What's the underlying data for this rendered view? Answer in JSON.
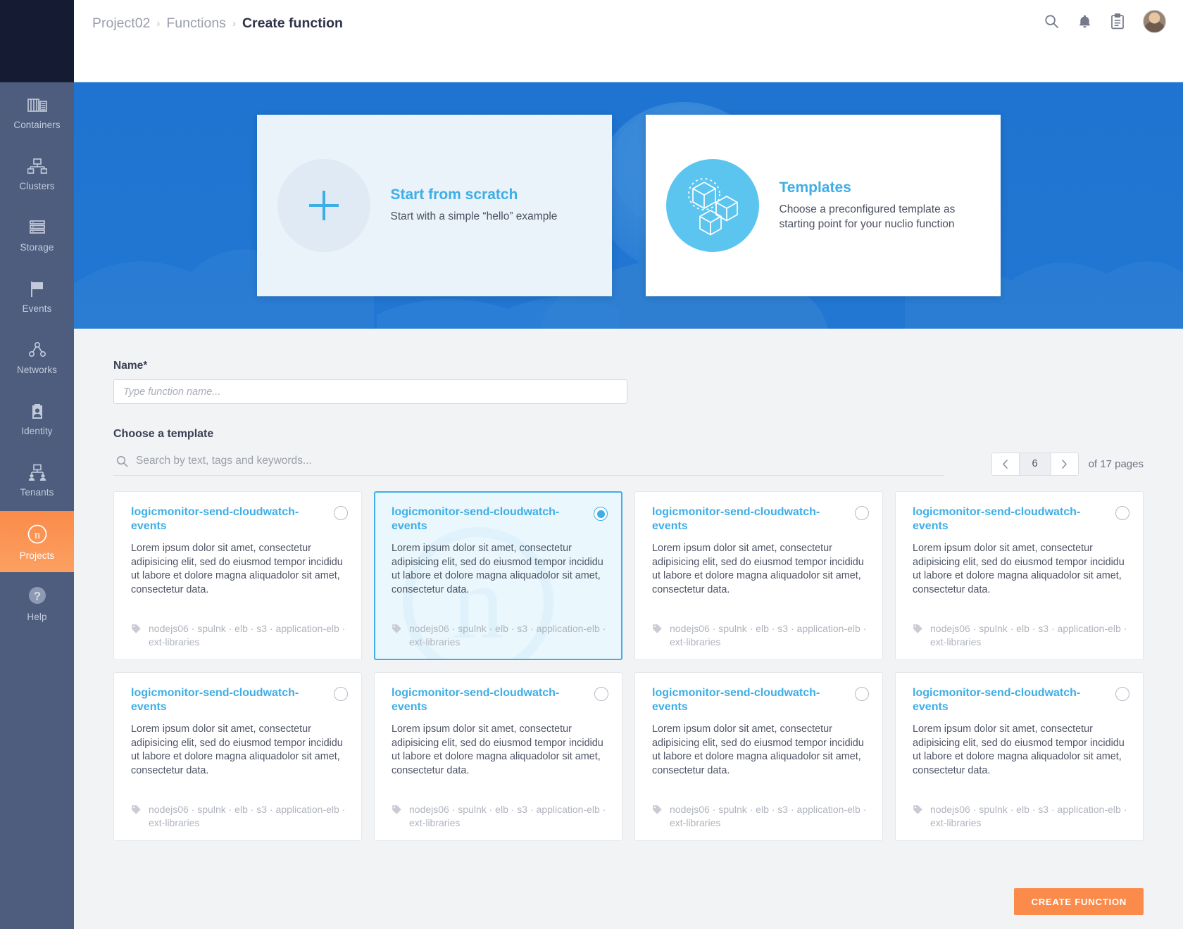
{
  "breadcrumb": {
    "items": [
      {
        "label": "Project02",
        "current": false
      },
      {
        "label": "Functions",
        "current": false
      },
      {
        "label": "Create function",
        "current": true
      }
    ],
    "separator": "›"
  },
  "header": {
    "icons": [
      "search-icon",
      "bell-icon",
      "clipboard-icon",
      "user-avatar"
    ]
  },
  "sidebar": {
    "items": [
      {
        "label": "Containers",
        "icon": "containers-icon",
        "active": false
      },
      {
        "label": "Clusters",
        "icon": "clusters-icon",
        "active": false
      },
      {
        "label": "Storage",
        "icon": "storage-icon",
        "active": false
      },
      {
        "label": "Events",
        "icon": "flag-icon",
        "active": false
      },
      {
        "label": "Networks",
        "icon": "networks-icon",
        "active": false
      },
      {
        "label": "Identity",
        "icon": "identity-badge-icon",
        "active": false
      },
      {
        "label": "Tenants",
        "icon": "tenants-icon",
        "active": false
      },
      {
        "label": "Projects",
        "icon": "nuclio-n-icon",
        "active": true
      },
      {
        "label": "Help",
        "icon": "question-circle-icon",
        "active": false
      }
    ]
  },
  "hero": {
    "cards": [
      {
        "id": "start-from-scratch",
        "title": "Start from scratch",
        "subtitle": "Start with a simple “hello” example",
        "icon": "plus-icon"
      },
      {
        "id": "templates",
        "title": "Templates",
        "subtitle": "Choose a preconfigured template as\nstarting point for your nuclio function",
        "icon": "cubes-icon"
      }
    ]
  },
  "form": {
    "name_label": "Name*",
    "name_value": "",
    "name_placeholder": "Type function name...",
    "section_title": "Choose a template"
  },
  "search": {
    "value": "",
    "placeholder": "Search by text, tags and keywords...",
    "icon": "search-icon"
  },
  "pagination": {
    "prev_icon": "chevron-left-icon",
    "next_icon": "chevron-right-icon",
    "current_page": "6",
    "total_label": "of 17 pages"
  },
  "templates": [
    {
      "title": "logicmonitor-send-cloudwatch-events",
      "description": "Lorem ipsum dolor sit amet, consectetur adipisicing elit, sed do eiusmod tempor incididu ut labore et dolore magna aliquadolor sit amet, consectetur data.",
      "tags": "nodejs06 · spulnk · elb · s3 · application-elb · ext-libraries",
      "selected": false
    },
    {
      "title": "logicmonitor-send-cloudwatch-events",
      "description": "Lorem ipsum dolor sit amet, consectetur adipisicing elit, sed do eiusmod tempor incididu ut labore et dolore magna aliquadolor sit amet, consectetur data.",
      "tags": "nodejs06 · spulnk · elb · s3 · application-elb · ext-libraries",
      "selected": true
    },
    {
      "title": "logicmonitor-send-cloudwatch-events",
      "description": "Lorem ipsum dolor sit amet, consectetur adipisicing elit, sed do eiusmod tempor incididu ut labore et dolore magna aliquadolor sit amet, consectetur data.",
      "tags": "nodejs06 · spulnk · elb · s3 · application-elb · ext-libraries",
      "selected": false
    },
    {
      "title": "logicmonitor-send-cloudwatch-events",
      "description": "Lorem ipsum dolor sit amet, consectetur adipisicing elit, sed do eiusmod tempor incididu ut labore et dolore magna aliquadolor sit amet, consectetur data.",
      "tags": "nodejs06 · spulnk · elb · s3 · application-elb · ext-libraries",
      "selected": false
    },
    {
      "title": "logicmonitor-send-cloudwatch-events",
      "description": "Lorem ipsum dolor sit amet, consectetur adipisicing elit, sed do eiusmod tempor incididu ut labore et dolore magna aliquadolor sit amet, consectetur data.",
      "tags": "nodejs06 · spulnk · elb · s3 · application-elb · ext-libraries",
      "selected": false
    },
    {
      "title": "logicmonitor-send-cloudwatch-events",
      "description": "Lorem ipsum dolor sit amet, consectetur adipisicing elit, sed do eiusmod tempor incididu ut labore et dolore magna aliquadolor sit amet, consectetur data.",
      "tags": "nodejs06 · spulnk · elb · s3 · application-elb · ext-libraries",
      "selected": false
    },
    {
      "title": "logicmonitor-send-cloudwatch-events",
      "description": "Lorem ipsum dolor sit amet, consectetur adipisicing elit, sed do eiusmod tempor incididu ut labore et dolore magna aliquadolor sit amet, consectetur data.",
      "tags": "nodejs06 · spulnk · elb · s3 · application-elb · ext-libraries",
      "selected": false
    },
    {
      "title": "logicmonitor-send-cloudwatch-events",
      "description": "Lorem ipsum dolor sit amet, consectetur adipisicing elit, sed do eiusmod tempor incididu ut labore et dolore magna aliquadolor sit amet, consectetur data.",
      "tags": "nodejs06 · spulnk · elb · s3 · application-elb · ext-libraries",
      "selected": false
    }
  ],
  "footer": {
    "create_label": "CREATE FUNCTION"
  },
  "colors": {
    "accent_blue": "#3eaee6",
    "hero_blue": "#1d72ce",
    "sidebar": "#4e5d7e",
    "sidebar_top": "#141b33",
    "orange": "#fb8b4b",
    "page_bg": "#f2f3f5"
  }
}
